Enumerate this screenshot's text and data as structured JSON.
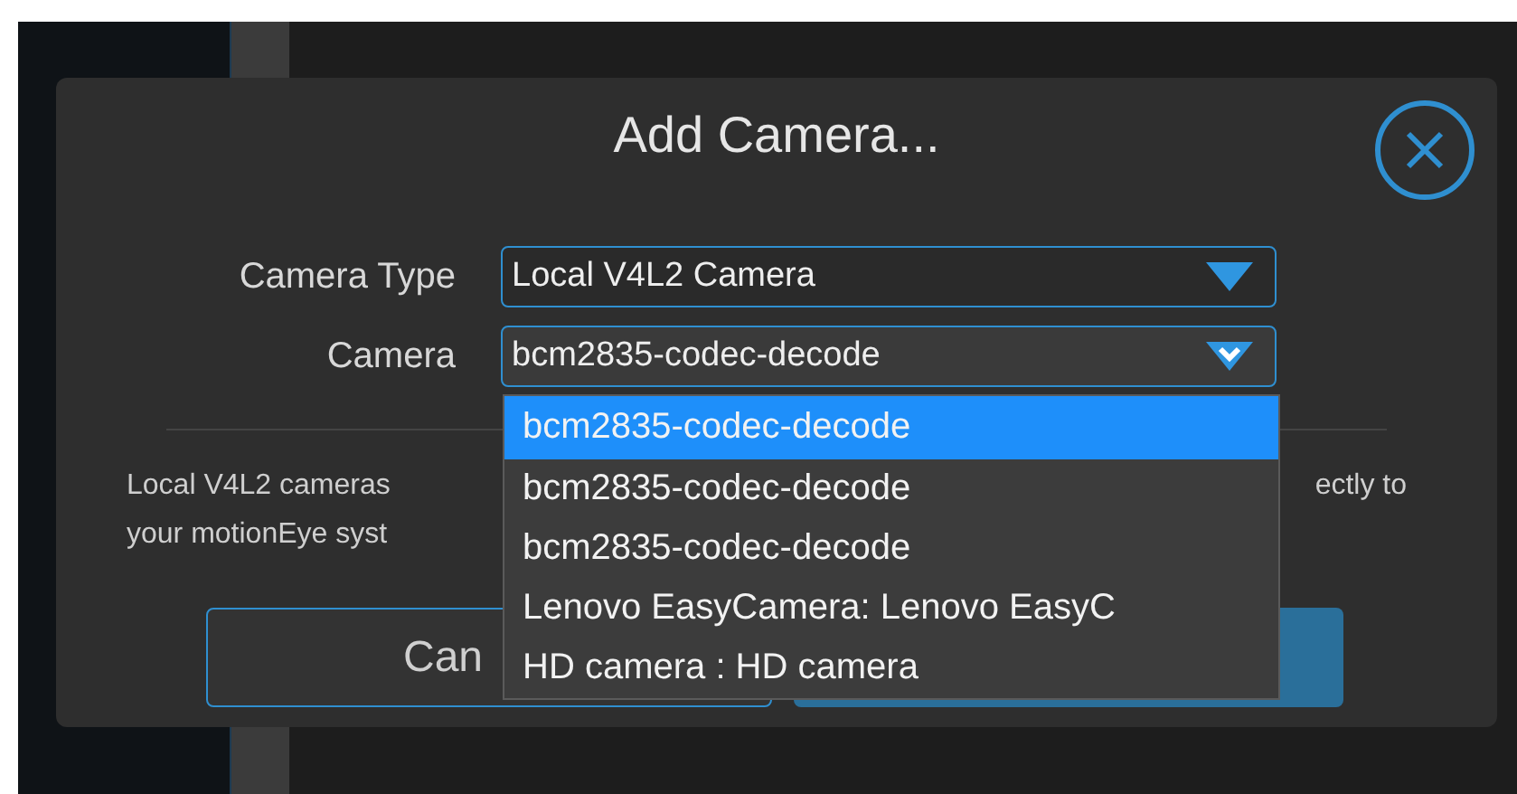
{
  "dialog": {
    "title": "Add Camera...",
    "fields": [
      {
        "label": "Camera Type",
        "value": "Local V4L2 Camera",
        "focused": false
      },
      {
        "label": "Camera",
        "value": "bcm2835-codec-decode",
        "focused": true
      }
    ],
    "dropdown": {
      "options": [
        {
          "label": "bcm2835-codec-decode",
          "selected": true
        },
        {
          "label": "bcm2835-codec-decode",
          "selected": false
        },
        {
          "label": "bcm2835-codec-decode",
          "selected": false
        },
        {
          "label": "Lenovo EasyCamera: Lenovo EasyC",
          "selected": false
        },
        {
          "label": "HD camera : HD camera",
          "selected": false
        }
      ]
    },
    "description": {
      "line_1_left": "Local V4L2 cameras",
      "line_1_right": "ectly to",
      "line_2": "your motionEye syst"
    },
    "buttons": [
      {
        "kind": "secondary",
        "label": "Can"
      },
      {
        "kind": "primary"
      }
    ]
  }
}
